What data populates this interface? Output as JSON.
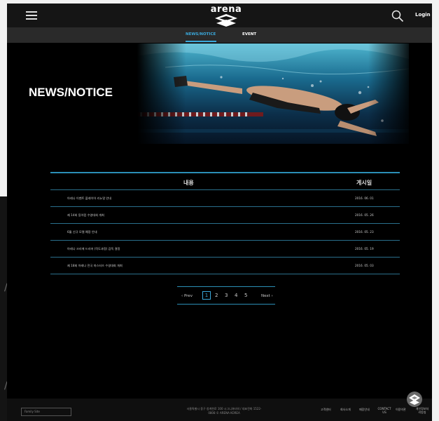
{
  "header": {
    "logo_text": "arena",
    "login_label": "Login"
  },
  "subnav": {
    "tabs": [
      {
        "label": "NEWS/NOTICE",
        "active": true
      },
      {
        "label": "EVENT",
        "active": false
      }
    ],
    "accent_color": "#3aa7d9"
  },
  "hero": {
    "title": "NEWS/NOTICE"
  },
  "board": {
    "col_content": "내용",
    "col_date": "게시일",
    "rows": [
      {
        "title": "아레나 이벤트 플레이어 리뉴얼 안내",
        "date": "2016. 06. 01"
      },
      {
        "title": "제 14회 동아컵 수영대회 개최",
        "date": "2016. 05. 26"
      },
      {
        "title": "6월 신규 모델 예정 안내",
        "date": "2016. 05. 23"
      },
      {
        "title": "아레나 크리에 드리머 (작도과정) 감독 결정",
        "date": "2016. 05. 19"
      },
      {
        "title": "제 18회 아레나 전국 마스터즈 수영대회 개최",
        "date": "2016. 05. 03"
      }
    ]
  },
  "pager": {
    "prev": "‹ Prev",
    "pages": [
      "1",
      "2",
      "3",
      "4",
      "5"
    ],
    "next": "Next ›"
  },
  "footer": {
    "family_site": "Family Site",
    "address_line1": "서울특별시 중구 청계천로 100 시그니쳐타워 / 대표전화 1522-",
    "address_line2": "0808 © ARENA KOREA",
    "links": [
      "고객센터",
      "회사소개",
      "매장안내",
      "CONTACT US",
      "이용약관",
      "개인정보처리방침"
    ]
  }
}
